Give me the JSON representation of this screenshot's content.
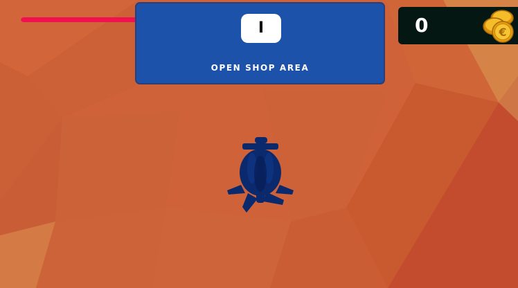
{
  "game": {
    "player_health_fraction": 1.0,
    "health_color": "#f0124e",
    "shop_prompt": {
      "key": "I",
      "label": "OPEN SHOP AREA",
      "panel_color": "#1d52ab"
    },
    "coins": {
      "count": "0",
      "icon": "euro-coin-stack-icon",
      "panel_color": "#041713"
    },
    "player": {
      "icon": "submarine-icon",
      "color": "#0b2a6e"
    },
    "background_color": "#cf6238"
  }
}
